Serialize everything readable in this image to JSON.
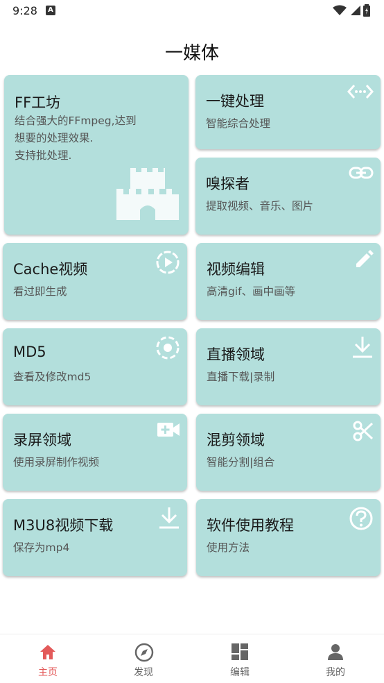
{
  "status_bar": {
    "time": "9:28",
    "notif_letter": "A"
  },
  "app": {
    "title": "一媒体"
  },
  "cards": [
    {
      "title": "FF工坊",
      "subtitle": "结合强大的FFmpeg,达到\n想要的处理效果.\n支持批处理.",
      "icon": "castle-icon"
    },
    {
      "title": "一键处理",
      "subtitle": "智能综合处理",
      "icon": "code-arrows-icon"
    },
    {
      "title": "嗅探者",
      "subtitle": "提取视频、音乐、图片",
      "icon": "link-icon"
    },
    {
      "title": "Cache视频",
      "subtitle": "看过即生成",
      "icon": "play-circle-icon"
    },
    {
      "title": "视频编辑",
      "subtitle": "高清gif、画中画等",
      "icon": "pencil-icon"
    },
    {
      "title": "MD5",
      "subtitle": "查看及修改md5",
      "icon": "target-icon"
    },
    {
      "title": "直播领域",
      "subtitle": "直播下载|录制",
      "icon": "download-icon"
    },
    {
      "title": "录屏领域",
      "subtitle": "使用录屏制作视频",
      "icon": "video-add-icon"
    },
    {
      "title": "混剪领域",
      "subtitle": "智能分割|组合",
      "icon": "scissors-icon"
    },
    {
      "title": "M3U8视频下载",
      "subtitle": "保存为mp4",
      "icon": "download-icon"
    },
    {
      "title": "软件使用教程",
      "subtitle": "使用方法",
      "icon": "help-icon"
    }
  ],
  "nav": [
    {
      "label": "主页",
      "icon": "home-icon",
      "active": true
    },
    {
      "label": "发现",
      "icon": "compass-icon",
      "active": false
    },
    {
      "label": "编辑",
      "icon": "dashboard-icon",
      "active": false
    },
    {
      "label": "我的",
      "icon": "person-icon",
      "active": false
    }
  ],
  "colors": {
    "card_bg": "#b3dfdc",
    "icon_tint": "#ffffff",
    "active_nav": "#e35a5a",
    "inactive_nav": "#666666"
  }
}
